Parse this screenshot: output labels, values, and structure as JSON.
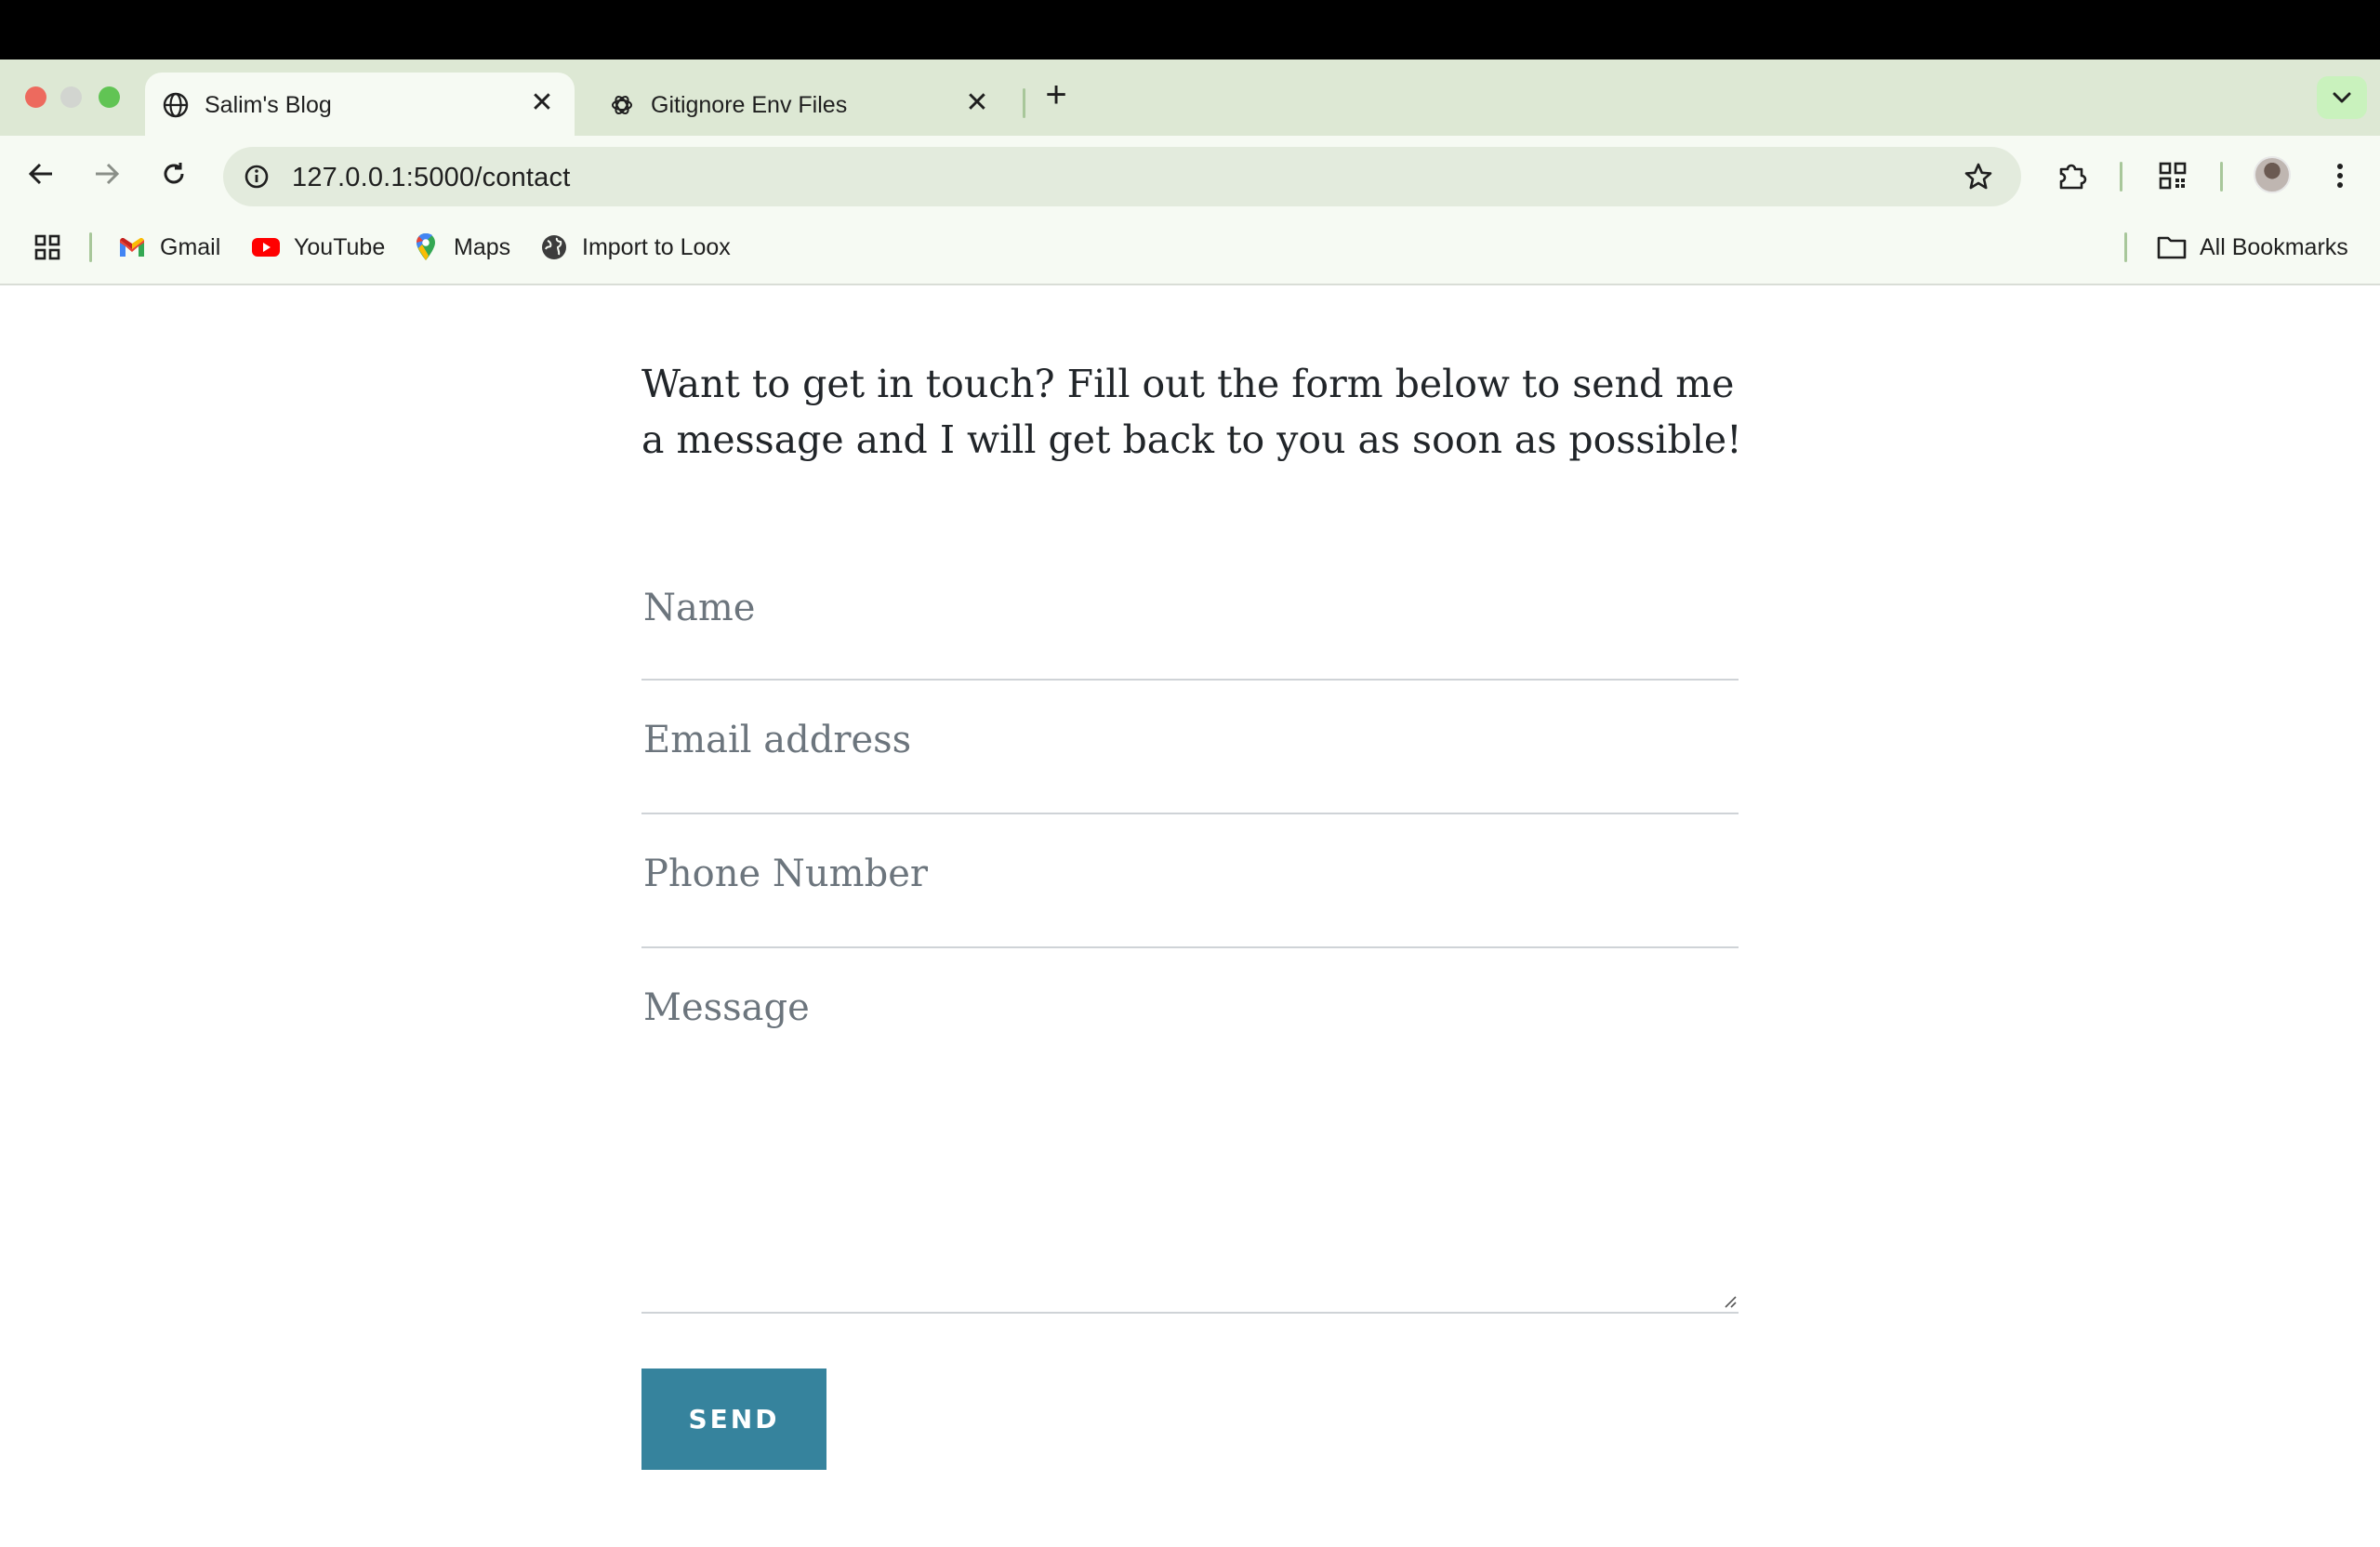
{
  "browser": {
    "tabs": [
      {
        "title": "Salim's Blog",
        "icon": "globe-icon",
        "active": true
      },
      {
        "title": "Gitignore Env Files",
        "icon": "openai-icon",
        "active": false
      }
    ],
    "url": "127.0.0.1:5000/contact",
    "bookmarks": [
      {
        "label": "Gmail",
        "icon": "gmail-icon"
      },
      {
        "label": "YouTube",
        "icon": "youtube-icon"
      },
      {
        "label": "Maps",
        "icon": "maps-icon"
      },
      {
        "label": "Import to Loox",
        "icon": "globe-icon"
      }
    ],
    "all_bookmarks_label": "All Bookmarks"
  },
  "contact": {
    "intro": "Want to get in touch? Fill out the form below to send me a message and I will get back to you as soon as possible!",
    "fields": {
      "name_placeholder": "Name",
      "email_placeholder": "Email address",
      "phone_placeholder": "Phone Number",
      "message_placeholder": "Message"
    },
    "send_label": "SEND"
  },
  "colors": {
    "chrome": "#dde8d4",
    "button": "#36839d",
    "text": "#212529",
    "placeholder": "#6c757d"
  }
}
